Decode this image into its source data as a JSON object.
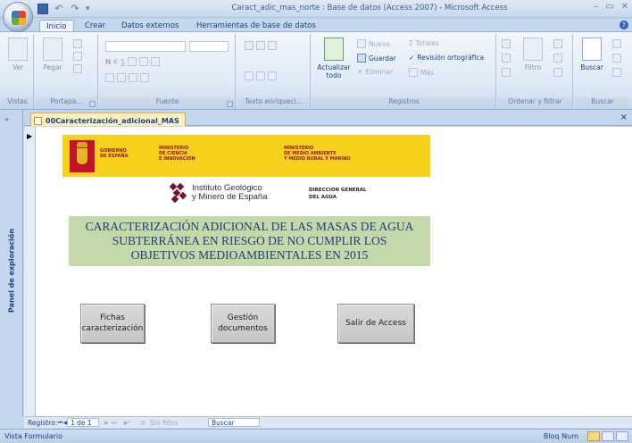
{
  "window": {
    "title": "Caract_adic_mas_norte : Base de datos (Access 2007) - Microsoft Access",
    "controls": [
      "–",
      "▭",
      "✕"
    ]
  },
  "quick_access": {
    "save_icon": "save-icon",
    "undo_icon": "undo-icon",
    "redo_icon": "redo-icon"
  },
  "tabs": [
    "Inicio",
    "Crear",
    "Datos externos",
    "Herramientas de base de datos"
  ],
  "ribbon": {
    "groups": {
      "vistas": "Vistas",
      "portapapeles": "Portapa...",
      "fuente": "Fuente",
      "texto": "Texto enriqueci...",
      "registros": "Registros",
      "ordenar": "Ordenar y filtrar",
      "buscar": "Buscar"
    },
    "ver_label": "Ver",
    "pegar_label": "Pegar",
    "actualizar_label": "Actualizar todo",
    "nuevo_label": "Nuevo",
    "totales_label": "Totales",
    "guardar_label": "Guardar",
    "revision_label": "Revisión ortográfica",
    "eliminar_label": "Eliminar",
    "mas_label": "Más",
    "filtro_label": "Filtro",
    "buscar_label": "Buscar",
    "bold": "N",
    "italic": "K",
    "underline": "S"
  },
  "nav_pane": {
    "label": "Panel de exploración",
    "toggle": "»"
  },
  "document": {
    "tab_label": "00Caracterización_adicional_MAS",
    "close": "×"
  },
  "banner": {
    "gobierno": "GOBIERNO\nDE ESPAÑA",
    "ministerio_ciencia": "MINISTERIO\nDE CIENCIA\nE INNOVACIÓN",
    "ministerio_medio": "MINISTERIO\nDE MEDIO AMBIENTE\nY MEDIO RURAL Y MARINO"
  },
  "igme": {
    "line1": "Instituto Geológico",
    "line2": "y Minero de España"
  },
  "direccion": {
    "line1": "DIRECCIÓN GENERAL",
    "line2": "DEL AGUA"
  },
  "form_title": {
    "line1": "CARACTERIZACIÓN ADICIONAL DE LAS MASAS DE AGUA",
    "line2": "SUBTERRÁNEA EN RIESGO DE NO CUMPLIR LOS",
    "line3": "OBJETIVOS MEDIOAMBIENTALES EN 2015"
  },
  "buttons": {
    "fichas_1": "Fichas",
    "fichas_2": "caracterización",
    "gestion_1": "Gestión",
    "gestion_2": "documentos",
    "salir": "Salir de Access"
  },
  "record_nav": {
    "label": "Registro:",
    "first": "⏮",
    "prev": "◀",
    "current": "1 de 1",
    "next": "▶",
    "last": "⏭",
    "filter": "Sin filtro",
    "search": "Buscar"
  },
  "status": {
    "left": "Vista Formulario",
    "right": "Bloq Num"
  }
}
